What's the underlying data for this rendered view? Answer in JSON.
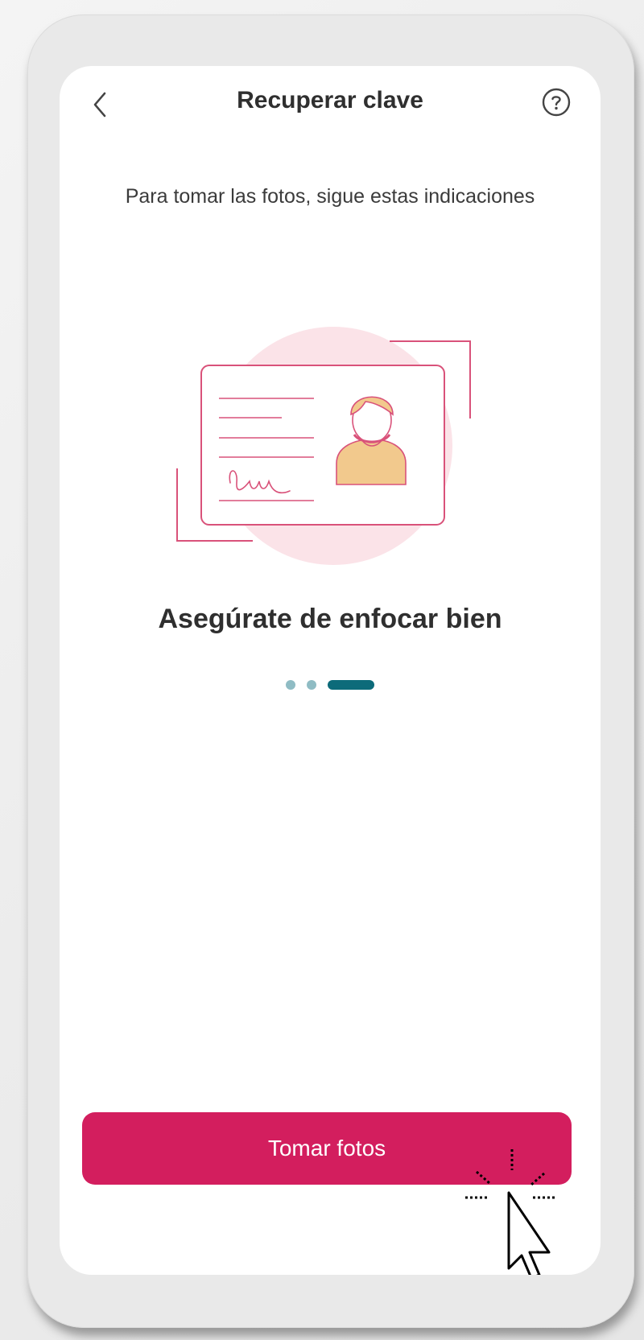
{
  "header": {
    "title": "Recuperar clave",
    "back_icon": "chevron-left-icon",
    "help_icon": "question-circle-icon"
  },
  "instructions": {
    "subtitle": "Para tomar las fotos, sigue estas indicaciones"
  },
  "carousel": {
    "illustration": "id-card-focus-illustration",
    "heading": "Asegúrate de enfocar bien",
    "total_steps": 3,
    "active_step": 3
  },
  "actions": {
    "primary_label": "Tomar fotos"
  },
  "colors": {
    "brand": "#d31e5e",
    "accent": "#0d6b7a",
    "dot_inactive": "#8fbcc4",
    "illustration_circle": "#fbe3e8",
    "illustration_line": "#d9527a",
    "avatar_skin": "#f2c98d"
  }
}
